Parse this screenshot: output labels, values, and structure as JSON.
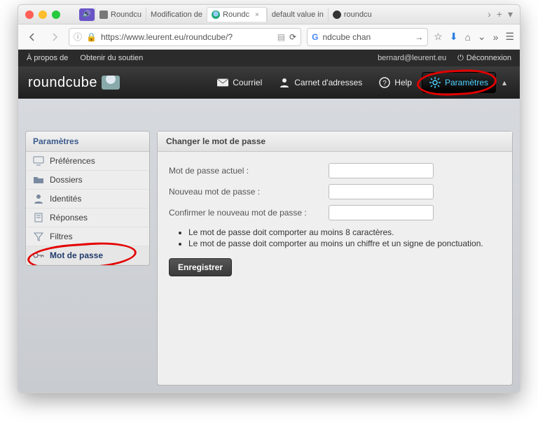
{
  "browser": {
    "tabs": [
      {
        "label": ""
      },
      {
        "label": "Roundcu"
      },
      {
        "label": "Modification de"
      },
      {
        "label": "Roundc",
        "active": true
      },
      {
        "label": "default value in"
      },
      {
        "label": "roundcu"
      }
    ],
    "url": "https://www.leurent.eu/roundcube/?",
    "search_placeholder": "ndcube chan"
  },
  "topbar": {
    "about": "À propos de",
    "support": "Obtenir du soutien",
    "user": "bernard@leurent.eu",
    "logout": "Déconnexion"
  },
  "header": {
    "logo": "roundcube",
    "nav": {
      "mail": "Courriel",
      "contacts": "Carnet d'adresses",
      "help": "Help",
      "settings": "Paramètres"
    }
  },
  "sidebar": {
    "title": "Paramètres",
    "items": [
      {
        "label": "Préférences"
      },
      {
        "label": "Dossiers"
      },
      {
        "label": "Identités"
      },
      {
        "label": "Réponses"
      },
      {
        "label": "Filtres"
      },
      {
        "label": "Mot de passe",
        "selected": true
      }
    ]
  },
  "panel": {
    "title": "Changer le mot de passe",
    "fields": {
      "current": "Mot de passe actuel :",
      "new": "Nouveau mot de passe :",
      "confirm": "Confirmer le nouveau mot de passe :"
    },
    "rules": [
      "Le mot de passe doit comporter au moins 8 caractères.",
      "Le mot de passe doit comporter au moins un chiffre et un signe de ponctuation."
    ],
    "save": "Enregistrer"
  }
}
